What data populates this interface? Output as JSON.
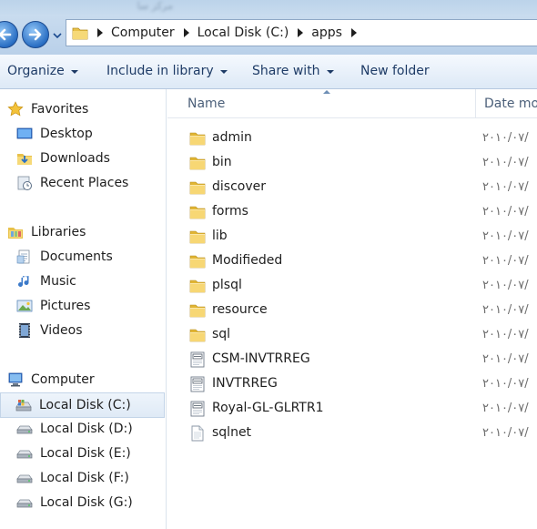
{
  "titlebar": {
    "blurred_text": "مرکز سا"
  },
  "address": {
    "crumbs": [
      "Computer",
      "Local Disk (C:)",
      "apps"
    ]
  },
  "toolbar": {
    "organize": "Organize",
    "include_in_library": "Include in library",
    "share_with": "Share with",
    "new_folder": "New folder"
  },
  "navigation": {
    "favorites": {
      "header": "Favorites",
      "items": [
        "Desktop",
        "Downloads",
        "Recent Places"
      ]
    },
    "libraries": {
      "header": "Libraries",
      "items": [
        "Documents",
        "Music",
        "Pictures",
        "Videos"
      ]
    },
    "computer": {
      "header": "Computer",
      "drives": [
        "Local Disk (C:)",
        "Local Disk (D:)",
        "Local Disk (E:)",
        "Local Disk (F:)",
        "Local Disk (G:)"
      ],
      "selected": "Local Disk (C:)"
    }
  },
  "columns": {
    "name": "Name",
    "date": "Date mo"
  },
  "files": [
    {
      "name": "admin",
      "type": "folder",
      "date": "۲۰۱۰/۰۷/"
    },
    {
      "name": "bin",
      "type": "folder",
      "date": "۲۰۱۰/۰۷/"
    },
    {
      "name": "discover",
      "type": "folder",
      "date": "۲۰۱۰/۰۷/"
    },
    {
      "name": "forms",
      "type": "folder",
      "date": "۲۰۱۰/۰۷/"
    },
    {
      "name": "lib",
      "type": "folder",
      "date": "۲۰۱۰/۰۷/"
    },
    {
      "name": "Modifieded",
      "type": "folder",
      "date": "۲۰۱۰/۰۷/"
    },
    {
      "name": "plsql",
      "type": "folder",
      "date": "۲۰۱۰/۰۷/"
    },
    {
      "name": "resource",
      "type": "folder",
      "date": "۲۰۱۰/۰۷/"
    },
    {
      "name": "sql",
      "type": "folder",
      "date": "۲۰۱۰/۰۷/"
    },
    {
      "name": "CSM-INVTRREG",
      "type": "ini-file",
      "date": "۲۰۱۰/۰۷/"
    },
    {
      "name": "INVTRREG",
      "type": "ini-file",
      "date": "۲۰۱۰/۰۷/"
    },
    {
      "name": "Royal-GL-GLRTR1",
      "type": "ini-file",
      "date": "۲۰۱۰/۰۷/"
    },
    {
      "name": "sqlnet",
      "type": "text-file",
      "date": "۲۰۱۰/۰۷/"
    }
  ]
}
